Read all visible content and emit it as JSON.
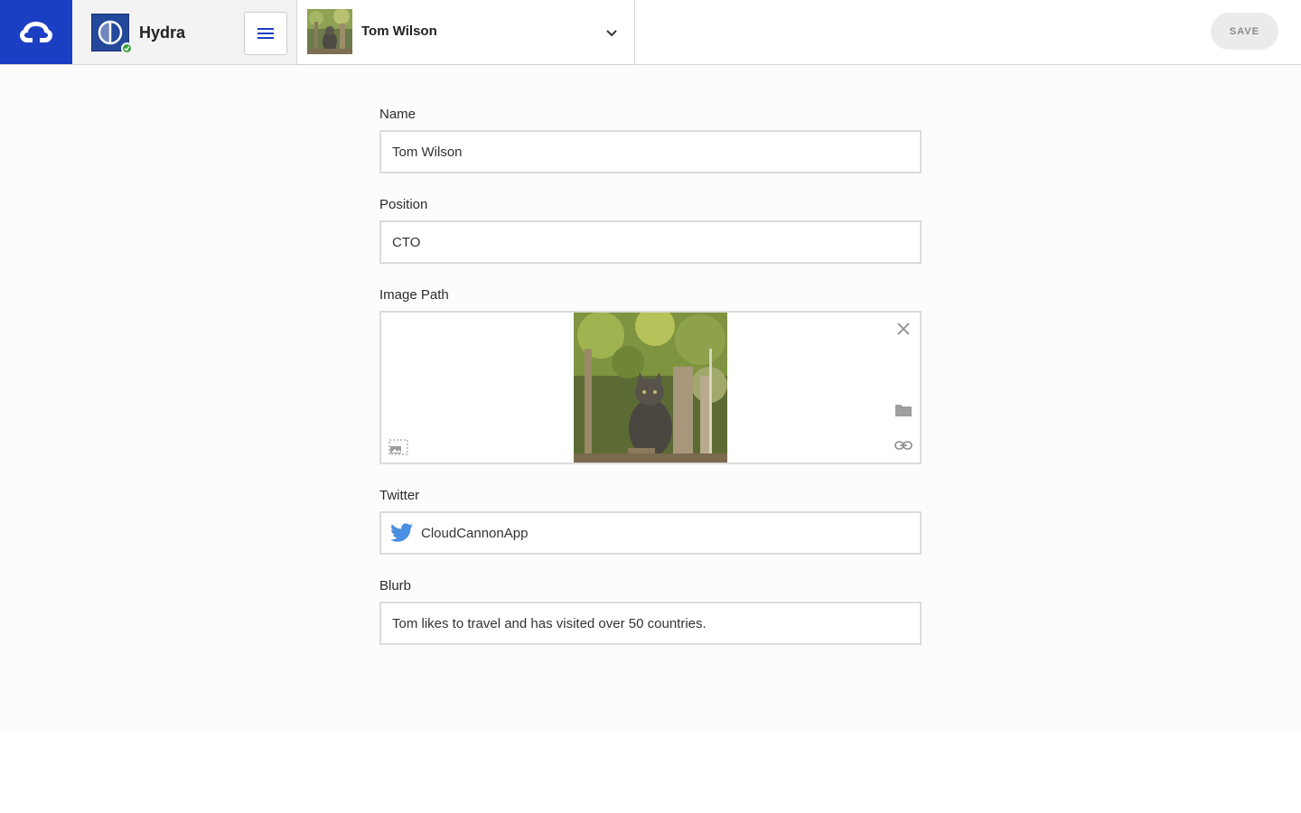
{
  "app": {
    "brand_icon": "cloudcannon-logo-icon",
    "brand_color": "#1b3fc2"
  },
  "site": {
    "name": "Hydra",
    "status": "synced",
    "status_color": "#35a33a",
    "menu_icon": "hamburger-menu-icon"
  },
  "file": {
    "title": "Tom Wilson",
    "dropdown_icon": "chevron-down-icon"
  },
  "toolbar": {
    "save_label": "SAVE"
  },
  "form": {
    "name": {
      "label": "Name",
      "value": "Tom Wilson"
    },
    "position": {
      "label": "Position",
      "value": "CTO"
    },
    "image_path": {
      "label": "Image Path",
      "preview_alt": "cat sitting on a wooden fence",
      "icons": [
        "close-icon",
        "folder-icon",
        "link-icon",
        "image-placeholder-icon"
      ]
    },
    "twitter": {
      "label": "Twitter",
      "value": "CloudCannonApp",
      "icon": "twitter-bird-icon",
      "icon_color": "#4a8fe0"
    },
    "blurb": {
      "label": "Blurb",
      "value": "Tom likes to travel and has visited over 50 countries."
    }
  }
}
